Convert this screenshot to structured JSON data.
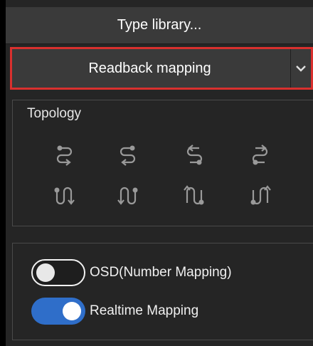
{
  "buttons": {
    "type_library": "Type library...",
    "readback_mapping": "Readback mapping"
  },
  "topology": {
    "title": "Topology",
    "icons": [
      "topology-loop-right-top-icon",
      "topology-loop-left-top-icon",
      "topology-loop-right-bottom-icon",
      "topology-loop-left-bottom-icon",
      "topology-snake-down-left-icon",
      "topology-snake-down-right-icon",
      "topology-snake-up-left-icon",
      "topology-snake-up-right-icon"
    ]
  },
  "mapping": {
    "osd_label": "OSD(Number Mapping)",
    "osd_on": false,
    "realtime_label": "Realtime Mapping",
    "realtime_on": true
  },
  "colors": {
    "highlight_border": "#d9302e",
    "toggle_on": "#2f6ec9",
    "icon": "#9a9a9a"
  }
}
